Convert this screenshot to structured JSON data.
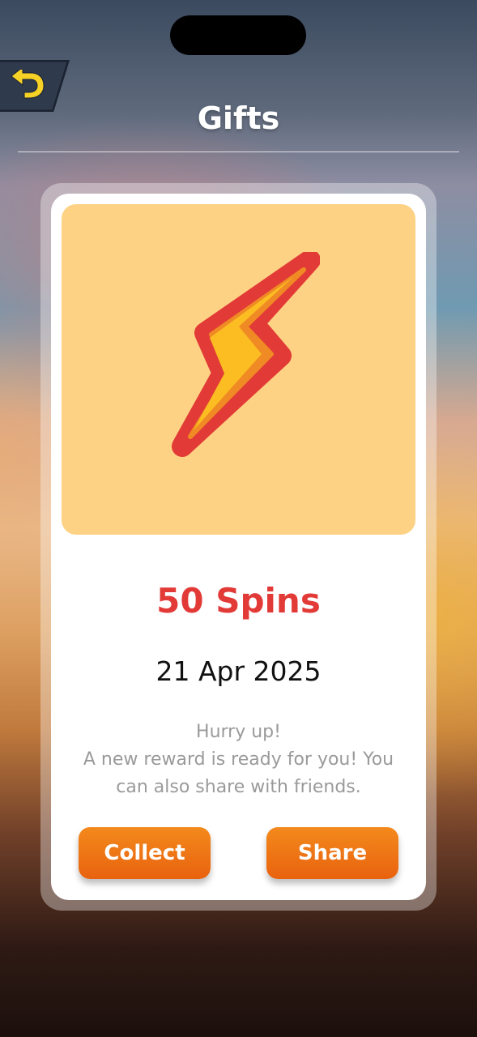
{
  "header": {
    "title": "Gifts",
    "back_icon": "back-arrow-icon"
  },
  "gift": {
    "icon": "lightning-bolt-icon",
    "amount": "50 Spins",
    "date": "21 Apr 2025",
    "description_line1": "Hurry up!",
    "description_line2": "A new reward is ready for you! You can also share with friends."
  },
  "actions": {
    "collect_label": "Collect",
    "share_label": "Share"
  },
  "colors": {
    "accent_red": "#e23a36",
    "button_orange": "#ee7316",
    "hero_background": "#fed284"
  }
}
